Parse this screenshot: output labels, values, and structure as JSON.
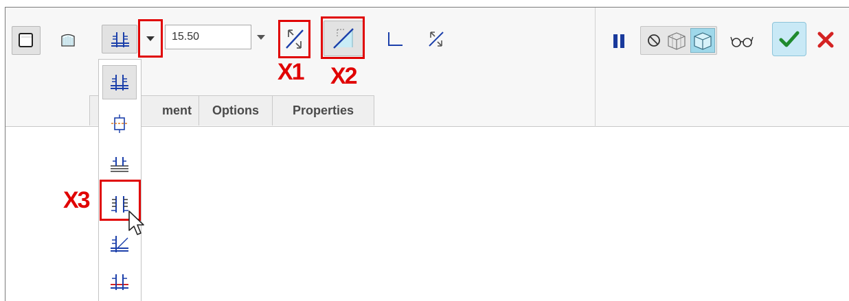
{
  "toolbar": {
    "thickness_value": "15.50",
    "left_buttons": [
      {
        "icon": "solid-body-icon"
      },
      {
        "icon": "surface-icon"
      },
      {
        "icon": "depth-type-icon"
      }
    ],
    "right_buttons": [
      {
        "icon": "pause-icon"
      },
      {
        "icon": "no-preview-icon"
      },
      {
        "icon": "preview-icon"
      },
      {
        "icon": "verify-icon"
      },
      {
        "icon": "apply-check-icon"
      },
      {
        "icon": "cancel-x-icon"
      }
    ]
  },
  "tabs": [
    {
      "label": "ment"
    },
    {
      "label": "Options"
    },
    {
      "label": "Properties"
    }
  ],
  "dropdown": {
    "items": [
      {
        "icon": "depth-symmetric-icon"
      },
      {
        "icon": "depth-to-selected-icon"
      },
      {
        "icon": "depth-through-all-icon"
      },
      {
        "icon": "depth-both-sides-icon"
      },
      {
        "icon": "depth-to-surface-icon"
      },
      {
        "icon": "depth-to-next-icon"
      }
    ]
  },
  "callouts": {
    "x1": "X1",
    "x2": "X2",
    "x3": "X3"
  },
  "colors": {
    "callout": "#e00000",
    "accent_blue": "#1b3faa",
    "check_green": "#1f8a2e",
    "cancel_red": "#d42323"
  }
}
